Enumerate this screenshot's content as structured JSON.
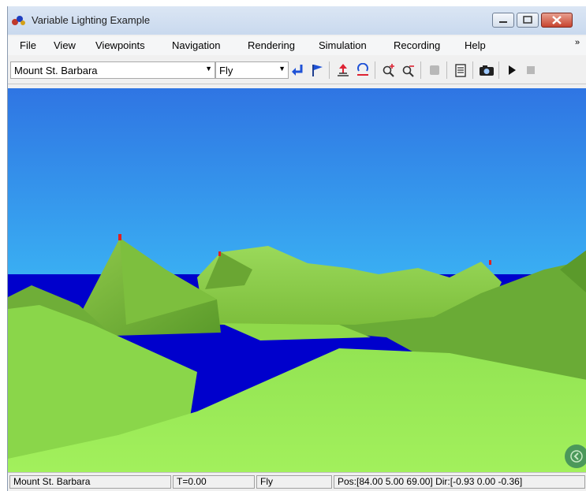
{
  "window": {
    "title": "Variable Lighting Example"
  },
  "menu": [
    "File",
    "View",
    "Viewpoints",
    "Navigation",
    "Rendering",
    "Simulation",
    "Recording",
    "Help"
  ],
  "toolbar": {
    "viewpoint": "Mount St. Barbara",
    "nav_mode": "Fly"
  },
  "status": {
    "viewpoint": "Mount St. Barbara",
    "time": "T=0.00",
    "mode": "Fly",
    "pos": "Pos:[84.00 5.00 69.00] Dir:[-0.93 0.00 -0.36]"
  },
  "colors": {
    "sky_top": "#2f75e3",
    "sky_bottom": "#50e4ff",
    "water": "#0000cc",
    "terrain": "#8fd94a"
  },
  "icons": [
    "undo-arrow-icon",
    "flag-icon",
    "go-up-icon",
    "straighten-icon",
    "zoom-in-icon",
    "zoom-out-icon",
    "record-icon",
    "clipboard-icon",
    "camera-icon",
    "play-icon",
    "stop-icon"
  ]
}
